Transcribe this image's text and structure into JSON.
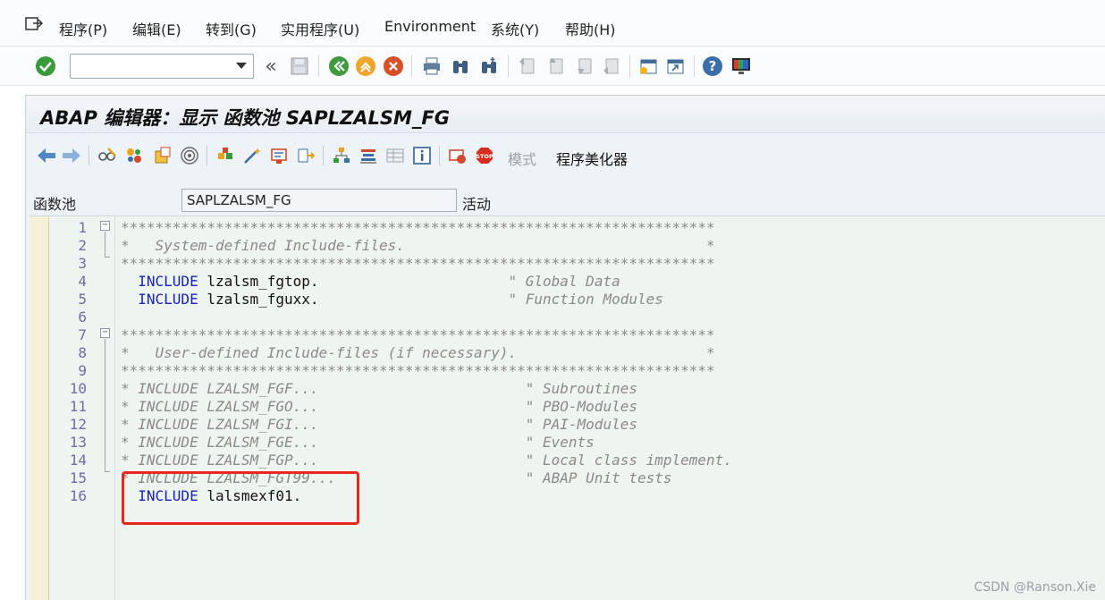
{
  "menubar": {
    "items": [
      "程序(P)",
      "编辑(E)",
      "转到(G)",
      "实用程序(U)",
      "Environment",
      "系统(Y)",
      "帮助(H)"
    ]
  },
  "toolbar": {
    "command_field": {
      "value": "",
      "placeholder": ""
    }
  },
  "window": {
    "title": "ABAP 编辑器：显示 函数池 SAPLZALSM_FG"
  },
  "app_toolbar": {
    "mode_label": "模式",
    "pretty_printer_label": "程序美化器"
  },
  "header_field": {
    "label": "函数池",
    "value": "SAPLZALSM_FG",
    "status": "活动"
  },
  "editor": {
    "lines": [
      {
        "no": "1",
        "text": "*********************************************************************",
        "type": "comment"
      },
      {
        "no": "2",
        "text": "*   System-defined Include-files.                                   *",
        "type": "comment"
      },
      {
        "no": "3",
        "text": "*********************************************************************",
        "type": "comment"
      },
      {
        "no": "4",
        "kw": "  INCLUDE",
        "text": " lzalsm_fgtop.",
        "comment": "                      \" Global Data",
        "type": "include"
      },
      {
        "no": "5",
        "kw": "  INCLUDE",
        "text": " lzalsm_fguxx.",
        "comment": "                      \" Function Modules",
        "type": "include"
      },
      {
        "no": "6",
        "text": "",
        "type": "blank"
      },
      {
        "no": "7",
        "text": "*********************************************************************",
        "type": "comment"
      },
      {
        "no": "8",
        "text": "*   User-defined Include-files (if necessary).                      *",
        "type": "comment"
      },
      {
        "no": "9",
        "text": "*********************************************************************",
        "type": "comment"
      },
      {
        "no": "10",
        "text": "* INCLUDE LZALSM_FGF...                        \" Subroutines",
        "type": "comment"
      },
      {
        "no": "11",
        "text": "* INCLUDE LZALSM_FGO...                        \" PBO-Modules",
        "type": "comment"
      },
      {
        "no": "12",
        "text": "* INCLUDE LZALSM_FGI...                        \" PAI-Modules",
        "type": "comment"
      },
      {
        "no": "13",
        "text": "* INCLUDE LZALSM_FGE...                        \" Events",
        "type": "comment"
      },
      {
        "no": "14",
        "text": "* INCLUDE LZALSM_FGP...                        \" Local class implement.",
        "type": "comment"
      },
      {
        "no": "15",
        "text": "* INCLUDE LZALSM_FGT99...                      \" ABAP Unit tests",
        "type": "comment"
      },
      {
        "no": "16",
        "kw": "  INCLUDE",
        "text": " lalsmexf01.",
        "comment": "",
        "type": "include"
      }
    ]
  },
  "watermark": "CSDN @Ranson.Xie",
  "colors": {
    "keyword": "#1a22b8",
    "comment": "#8a8a8a",
    "highlight": "#e8271f"
  }
}
